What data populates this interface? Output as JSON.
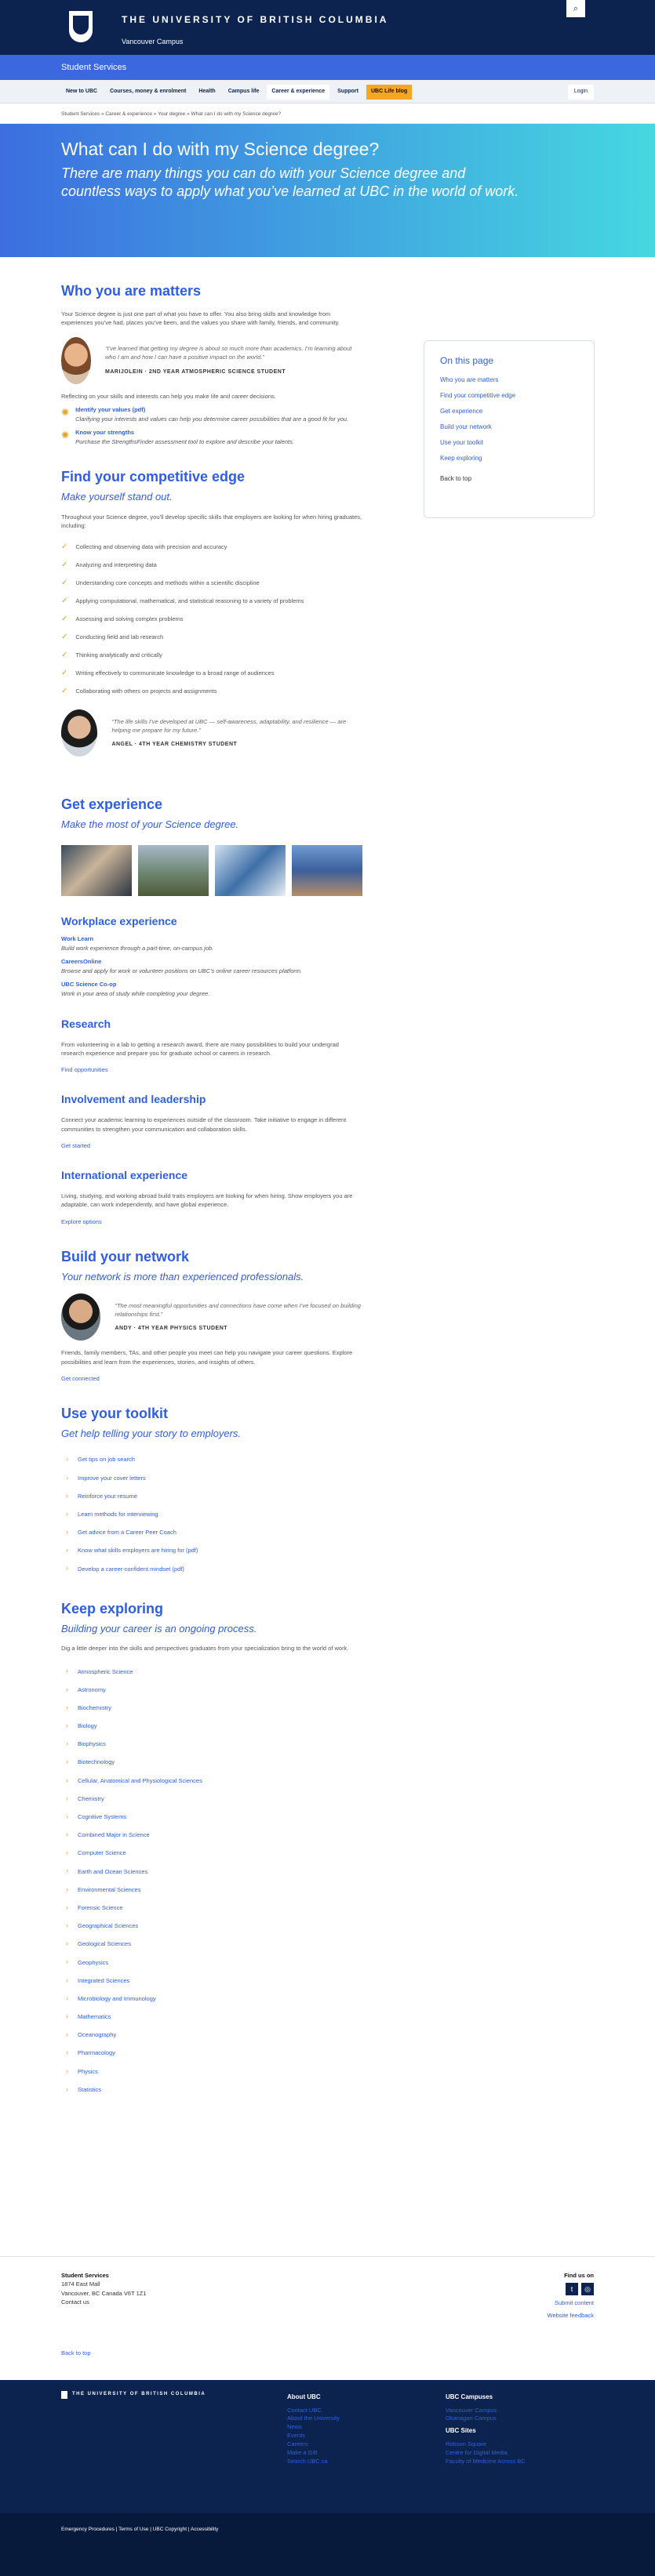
{
  "header": {
    "university": "THE UNIVERSITY OF BRITISH COLUMBIA",
    "campus": "Vancouver Campus",
    "unit": "Student Services",
    "search_icon": "search-icon"
  },
  "nav": {
    "items": [
      "New to UBC",
      "Courses, money & enrolment",
      "Health",
      "Campus life",
      "Career & experience",
      "Support",
      "UBC Life blog"
    ],
    "login": "Login"
  },
  "breadcrumb": "Student Services » Career & experience » Your degree » What can I do with my Science degree?",
  "hero": {
    "title": "What can I do with my Science degree?",
    "subtitle": "There are many things you can do with your Science degree and countless ways to apply what you’ve learned at UBC in the world of work."
  },
  "aside": {
    "title": "On this page",
    "links": [
      "Who you are matters",
      "Find your competitive edge",
      "Get experience",
      "Build your network",
      "Use your toolkit",
      "Keep exploring"
    ],
    "back": "Back to top"
  },
  "who": {
    "title": "Who you are matters",
    "intro": "Your Science degree is just one part of what you have to offer. You also bring skills and knowledge from experiences you’ve had, places you’ve been, and the values you share with family, friends, and community.",
    "quote": "“I’ve learned that getting my degree is about so much more than academics. I’m learning about who I am and how I can have a positive impact on the world.”",
    "name": "MARIJOLEIN · 2ND YEAR ATMOSPHERIC SCIENCE STUDENT",
    "reflect": "Reflecting on your skills and interests can help you make life and career decisions.",
    "tip1_link": "Identify your values (pdf)",
    "tip1_text": "Clarifying your interests and values can help you determine career possibilities that are a good fit for you.",
    "tip2_link": "Know your strengths",
    "tip2_text": "Purchase the StrengthsFinder assessment tool to explore and describe your talents."
  },
  "edge": {
    "title": "Find your competitive edge",
    "subtitle": "Make yourself stand out.",
    "intro": "Throughout your Science degree, you’ll develop specific skills that employers are looking for when hiring graduates, including:",
    "skills": [
      "Collecting and observing data with precision and accuracy",
      "Analyzing and interpreting data",
      "Understanding core concepts and methods within a scientific discipline",
      "Applying computational, mathematical, and statistical reasoning to a variety of problems",
      "Assessing and solving complex problems",
      "Conducting field and lab research",
      "Thinking analytically and critically",
      "Writing effectively to communicate knowledge to a broad range of audiences",
      "Collaborating with others on projects and assignments"
    ],
    "quote": "“The life skills I’ve developed at UBC — self-awareness, adaptability, and resilience — are helping me prepare for my future.”",
    "name": "ANGEL · 4TH YEAR CHEMISTRY STUDENT"
  },
  "exp": {
    "title": "Get experience",
    "subtitle": "Make the most of your Science degree.",
    "work_title": "Workplace experience",
    "work_learn": "Work Learn",
    "work_learn_text": "Build work experience through a part-time, on-campus job.",
    "cco": "CareersOnline",
    "cco_text": "Browse and apply for work or volunteer positions on UBC’s online career resources platform.",
    "coop": "UBC Science Co-op",
    "coop_text": "Work in your area of study while completing your degree.",
    "research_title": "Research",
    "research_text": "From volunteering in a lab to getting a research award, there are many possibilities to build your undergrad research experience and prepare you for graduate school or careers in research.",
    "research_link": "Find opportunities",
    "inv_title": "Involvement and leadership",
    "inv_text": "Connect your academic learning to experiences outside of the classroom. Take initiative to engage in different communities to strengthen your communication and collaboration skills.",
    "inv_link": "Get started",
    "intl_title": "International experience",
    "intl_text": "Living, studying, and working abroad build traits employers are looking for when hiring. Show employers you are adaptable, can work independently, and have global experience.",
    "intl_link": "Explore options"
  },
  "network": {
    "title": "Build your network",
    "subtitle": "Your network is more than experienced professionals.",
    "quote": "“The most meaningful opportunities and connections have come when I’ve focused on building relationships first.”",
    "name": "ANDY · 4TH YEAR PHYSICS STUDENT",
    "text": "Friends, family members, TAs, and other people you meet can help you navigate your career questions. Explore possibilities and learn from the experiences, stories, and insights of others.",
    "link": "Get connected"
  },
  "toolkit": {
    "title": "Use your toolkit",
    "subtitle": "Get help telling your story to employers.",
    "links": [
      "Get tips on job search",
      "Improve your cover letters",
      "Reinforce your resume",
      "Learn methods for interviewing",
      "Get advice from a Career Peer Coach",
      "Know what skills employers are hiring for (pdf)",
      "Develop a career-confident mindset (pdf)"
    ]
  },
  "explore": {
    "title": "Keep exploring",
    "subtitle": "Building your career is an ongoing process.",
    "intro": "Dig a little deeper into the skills and perspectives graduates from your specialization bring to the world of work.",
    "links": [
      "Atmospheric Science",
      "Astronomy",
      "Biochemistry",
      "Biology",
      "Biophysics",
      "Biotechnology",
      "Cellular, Anatomical and Physiological Sciences",
      "Chemistry",
      "Cognitive Systems",
      "Combined Major in Science",
      "Computer Science",
      "Earth and Ocean Sciences",
      "Environmental Sciences",
      "Forensic Science",
      "Geographical Sciences",
      "Geological Sciences",
      "Geophysics",
      "Integrated Sciences",
      "Microbiology and Immunology",
      "Mathematics",
      "Oceanography",
      "Pharmacology",
      "Physics",
      "Statistics"
    ]
  },
  "footer": {
    "unit": "Student Services",
    "address1": "1874 East Mall",
    "address2": "Vancouver, BC Canada V6T 1Z1",
    "contact": "Contact us",
    "find": "Find us on",
    "submit": "Submit content",
    "feedback": "Website feedback",
    "back": "Back to top",
    "ubc": "THE UNIVERSITY OF BRITISH COLUMBIA",
    "about_title": "About UBC",
    "about": [
      "Contact UBC",
      "About the University",
      "News",
      "Events",
      "Careers",
      "Make a Gift",
      "Search UBC.ca"
    ],
    "campuses_title": "UBC Campuses",
    "campuses": [
      "Vancouver Campus",
      "Okanagan Campus"
    ],
    "sites_title": "UBC Sites",
    "sites": [
      "Robson Square",
      "Centre for Digital Media",
      "Faculty of Medicine Across BC"
    ],
    "bottom": "Emergency Procedures  |  Terms of Use  |  UBC Copyright  |  Accessibility"
  }
}
